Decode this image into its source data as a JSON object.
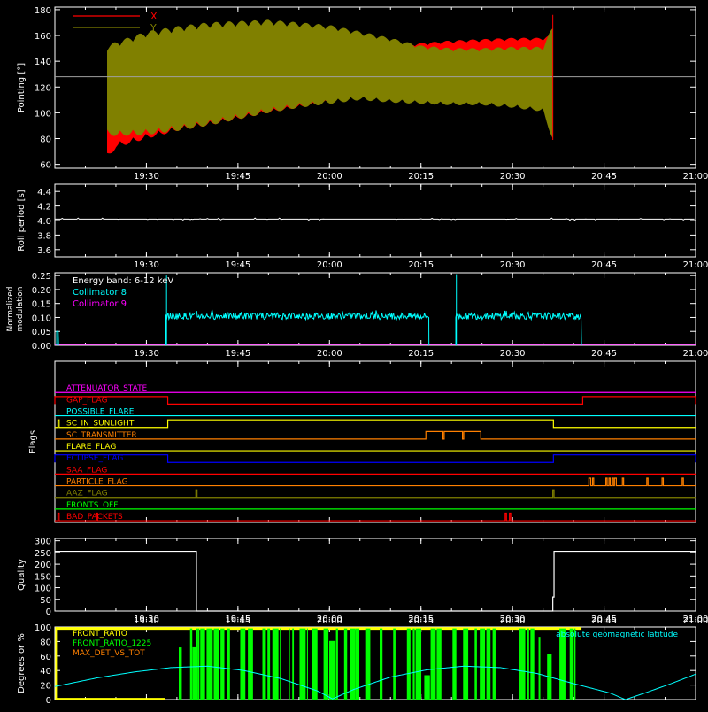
{
  "time_axis": {
    "start_min": 1155,
    "end_min": 1260,
    "ticks": [
      {
        "t": 1170,
        "label": "19:30"
      },
      {
        "t": 1185,
        "label": "19:45"
      },
      {
        "t": 1200,
        "label": "20:00"
      },
      {
        "t": 1215,
        "label": "20:15"
      },
      {
        "t": 1230,
        "label": "20:30"
      },
      {
        "t": 1245,
        "label": "20:45"
      },
      {
        "t": 1260,
        "label": "21:00"
      }
    ]
  },
  "chart_data": [
    {
      "id": "pointing",
      "type": "area",
      "ylabel": "Pointing [°]",
      "ylim": [
        57,
        182
      ],
      "yticks": [
        60,
        80,
        100,
        120,
        140,
        160,
        180
      ],
      "reference_line": 128,
      "legend": [
        {
          "name": "X",
          "color": "#ff0000"
        },
        {
          "name": "Y",
          "color": "#808000"
        }
      ],
      "data_window": [
        1163.6,
        1236.6
      ],
      "series": [
        {
          "name": "X",
          "color": "#ff0000",
          "x": [
            1163.6,
            1165,
            1170,
            1175,
            1180,
            1185,
            1190,
            1195,
            1200,
            1205,
            1210,
            1215,
            1220,
            1225,
            1230,
            1235,
            1236.6
          ],
          "max": [
            147,
            148,
            150,
            152,
            152,
            151,
            150,
            149,
            148,
            150,
            152,
            154,
            156,
            157,
            158,
            158,
            161
          ],
          "min": [
            64,
            73,
            80,
            86,
            90,
            95,
            100,
            104,
            108,
            113,
            115,
            118,
            119,
            120,
            121,
            122,
            118
          ]
        },
        {
          "name": "Y",
          "color": "#808000",
          "x": [
            1163.6,
            1165,
            1170,
            1175,
            1180,
            1185,
            1190,
            1195,
            1200,
            1205,
            1210,
            1215,
            1220,
            1225,
            1230,
            1235,
            1236.6
          ],
          "max": [
            152,
            155,
            163,
            167,
            170,
            171,
            172,
            170,
            168,
            163,
            158,
            152,
            150,
            150,
            151,
            151,
            167
          ],
          "min": [
            83,
            82,
            83,
            86,
            90,
            95,
            100,
            104,
            107,
            110,
            108,
            107,
            106,
            106,
            104,
            101,
            79
          ]
        }
      ]
    },
    {
      "id": "roll",
      "type": "line",
      "ylabel": "Roll period [s]",
      "ylim": [
        3.5,
        4.5
      ],
      "yticks": [
        3.6,
        3.8,
        4.0,
        4.2,
        4.4
      ],
      "yticklabels": [
        "3.6",
        "3.8",
        "4.0",
        "4.2",
        "4.4"
      ],
      "series": [
        {
          "name": "Roll period",
          "color": "#ffffff",
          "x": [
            1155,
            1188,
            1190,
            1210,
            1215,
            1226,
            1228,
            1244,
            1250,
            1260
          ],
          "y": [
            4.02,
            4.02,
            4.02,
            4.02,
            4.02,
            4.02,
            4.02,
            4.02,
            4.02,
            4.02
          ]
        }
      ]
    },
    {
      "id": "modulation",
      "type": "line",
      "ylabel": [
        "Normalized",
        "modulation"
      ],
      "ylim": [
        0,
        0.26
      ],
      "yticks": [
        0.0,
        0.05,
        0.1,
        0.15,
        0.2,
        0.25
      ],
      "yticklabels": [
        "0.00",
        "0.05",
        "0.10",
        "0.15",
        "0.20",
        "0.25"
      ],
      "legend_title": "Energy band: 6-12 keV",
      "legend": [
        {
          "name": "Collimator 8",
          "color": "#00ffff"
        },
        {
          "name": "Collimator 9",
          "color": "#ff00ff"
        }
      ],
      "segments": [
        {
          "from": 1155.3,
          "to": 1155.6,
          "level": 0.05,
          "color": "#00ffff"
        },
        {
          "from": 1173.2,
          "to": 1216.3,
          "level": 0.105,
          "color": "#00ffff",
          "noise": 0.012
        },
        {
          "from": 1220.7,
          "to": 1241.3,
          "level": 0.105,
          "color": "#00ffff",
          "noise": 0.012
        }
      ],
      "spikes": [
        {
          "t": 1173.3,
          "value": 0.25
        },
        {
          "t": 1220.8,
          "value": 0.255
        }
      ],
      "baseline_color": "#ff00ff"
    },
    {
      "id": "flags",
      "type": "table",
      "ylabel": "Flags",
      "rows": [
        {
          "name": "ATTENUATOR_STATE",
          "color": "#ff00ff",
          "highs": []
        },
        {
          "name": "GAP_FLAG",
          "color": "#ff0000",
          "highs": [
            [
              1155,
              1173.5
            ],
            [
              1241.5,
              1260
            ]
          ]
        },
        {
          "name": "POSSIBLE_FLARE",
          "color": "#00ffff",
          "highs": []
        },
        {
          "name": "SC_IN_SUNLIGHT",
          "color": "#ffff00",
          "highs": [
            [
              1155.5,
              1155.7
            ],
            [
              1173.5,
              1236.7
            ]
          ]
        },
        {
          "name": "SC_TRANSMITTER",
          "color": "#ff8000",
          "highs": [
            [
              1215.8,
              1218.6
            ],
            [
              1218.8,
              1221.8
            ],
            [
              1222.0,
              1224.8
            ]
          ]
        },
        {
          "name": "FLARE_FLAG",
          "color": "#ffff00",
          "highs": []
        },
        {
          "name": "ECLIPSE_FLAG",
          "color": "#0000ff",
          "highs": [
            [
              1155,
              1173.5
            ],
            [
              1236.7,
              1260
            ]
          ]
        },
        {
          "name": "SAA_FLAG",
          "color": "#ff0000",
          "highs": []
        },
        {
          "name": "PARTICLE_FLAG",
          "color": "#ff8000",
          "highs": [
            [
              1242.5,
              1242.8
            ],
            [
              1243.1,
              1243.3
            ],
            [
              1245.3,
              1245.5
            ],
            [
              1245.8,
              1246
            ],
            [
              1246.3,
              1246.5
            ],
            [
              1246.7,
              1247
            ],
            [
              1248,
              1248.2
            ],
            [
              1252,
              1252.2
            ],
            [
              1254.5,
              1254.7
            ],
            [
              1257.8,
              1258
            ]
          ]
        },
        {
          "name": "AAZ_FLAG",
          "color": "#808000",
          "highs": [
            [
              1178.1,
              1178.3
            ],
            [
              1236.6,
              1236.8
            ]
          ]
        },
        {
          "name": "FRONTS_OFF",
          "color": "#00ff00",
          "highs": []
        },
        {
          "name": "BAD_PACKETS",
          "color": "#ff0000",
          "highs": [
            [
              1155.5,
              1155.7
            ],
            [
              1161.8,
              1162
            ],
            [
              1228.8,
              1229
            ],
            [
              1229.5,
              1229.7
            ]
          ]
        }
      ]
    },
    {
      "id": "quality",
      "type": "line",
      "ylabel": "Quality",
      "ylim": [
        0,
        310
      ],
      "yticks": [
        0,
        50,
        100,
        150,
        200,
        250,
        300
      ],
      "series": [
        {
          "name": "Quality",
          "color": "#ffffff",
          "x": [
            1155,
            1178.2,
            1178.2,
            1236.6,
            1236.6,
            1236.8,
            1236.8,
            1260
          ],
          "y": [
            255,
            255,
            0,
            0,
            60,
            60,
            255,
            255
          ]
        }
      ]
    },
    {
      "id": "geomag",
      "type": "line",
      "ylabel": "Degrees or %",
      "ylim": [
        0,
        100
      ],
      "yticks": [
        0,
        20,
        40,
        60,
        80,
        100
      ],
      "legend": [
        {
          "name": "FRONT_RATIO",
          "color": "#ffff00"
        },
        {
          "name": "FRONT_RATIO_1225",
          "color": "#00ff00"
        },
        {
          "name": "MAX_DET_VS_TOT",
          "color": "#ff8000"
        }
      ],
      "legend_right": {
        "name": "absolute geomagnetic latitude",
        "color": "#00ffff"
      },
      "front_ratio_window": [
        1155.2,
        1241.3
      ],
      "front_ratio_data_start": 1173.0,
      "latitude": {
        "color": "#00ffff",
        "x": [
          1155,
          1162,
          1168,
          1174,
          1180,
          1186,
          1192,
          1198,
          1200.5,
          1204,
          1210,
          1216,
          1222,
          1228,
          1234,
          1240,
          1246,
          1248.5,
          1252,
          1256,
          1260
        ],
        "y": [
          18,
          30,
          38,
          44,
          46,
          40,
          29,
          12,
          1,
          14,
          31,
          41,
          46,
          44,
          36,
          22,
          9,
          0,
          10,
          22,
          35
        ]
      }
    }
  ]
}
